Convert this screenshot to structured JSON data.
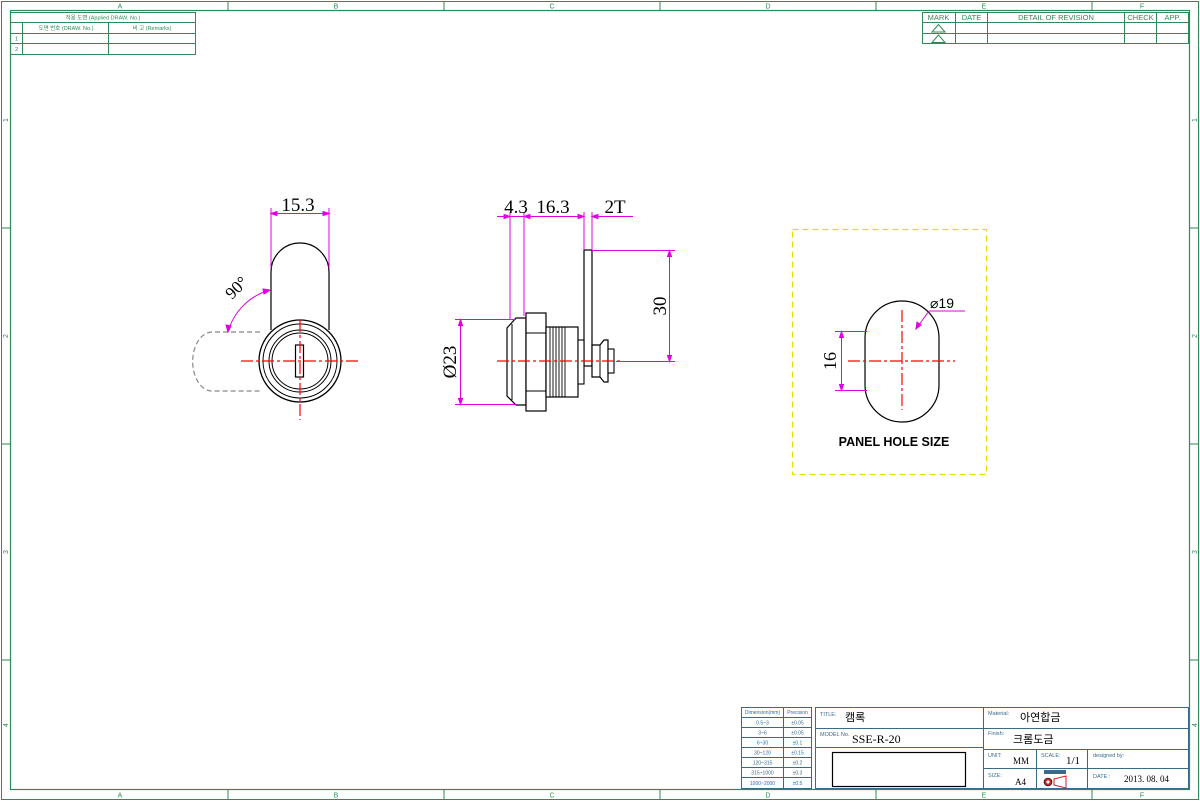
{
  "colors": {
    "frame": "#2e8b57",
    "dimension": "#e000e0",
    "centerline": "#ff0000",
    "hidden": "#888888",
    "panel_box": "#e0e000",
    "table": "#3a6a8a",
    "outline": "#000000"
  },
  "frame": {
    "columns": [
      "A",
      "B",
      "C",
      "D",
      "E",
      "F"
    ],
    "rows": [
      "1",
      "2",
      "3",
      "4"
    ]
  },
  "applied_table": {
    "title": "적용 도면 (Applied DRAW. No.)",
    "col1": "도면 번호 (DRAW. No.)",
    "col2": "비 고 (Remarks)",
    "rows": [
      "1",
      "2"
    ]
  },
  "revision_table": {
    "headers": [
      "MARK",
      "DATE",
      "DETAIL OF REVISION",
      "CHECK",
      "APP."
    ]
  },
  "views": {
    "front": {
      "width_dim": "15.3",
      "angle_dim": "90°"
    },
    "side": {
      "dim_a": "4.3",
      "dim_b": "16.3",
      "dim_thickness": "2T",
      "dim_height": "30",
      "dim_diameter": "Ø23"
    },
    "panel": {
      "diameter": "⌀19",
      "flat": "16",
      "caption": "PANEL HOLE SIZE"
    }
  },
  "tolerance_table": {
    "headers": [
      "Dimension(mm)",
      "Precision"
    ],
    "rows": [
      [
        "0.5~3",
        "±0.05"
      ],
      [
        "3~6",
        "±0.05"
      ],
      [
        "6~30",
        "±0.1"
      ],
      [
        "30~120",
        "±0.15"
      ],
      [
        "120~315",
        "±0.2"
      ],
      [
        "315~1000",
        "±0.3"
      ],
      [
        "1000~2000",
        "±0.5"
      ]
    ]
  },
  "title_block": {
    "title_label": "TITLE:",
    "title_value": "캠록",
    "model_label": "MODEL No.",
    "model_value": "SSE-R-20",
    "material_label": "Material:",
    "material_value": "아연합금",
    "finish_label": "Finish:",
    "finish_value": "크롬도금",
    "unit_label": "UNIT:",
    "unit_value": "MM",
    "scale_label": "SCALE:",
    "scale_value": "1/1",
    "size_label": "SIZE:",
    "size_value": "A4",
    "designed_label": "designed by:",
    "date_label": "DATE :",
    "date_value": "2013. 08. 04"
  }
}
